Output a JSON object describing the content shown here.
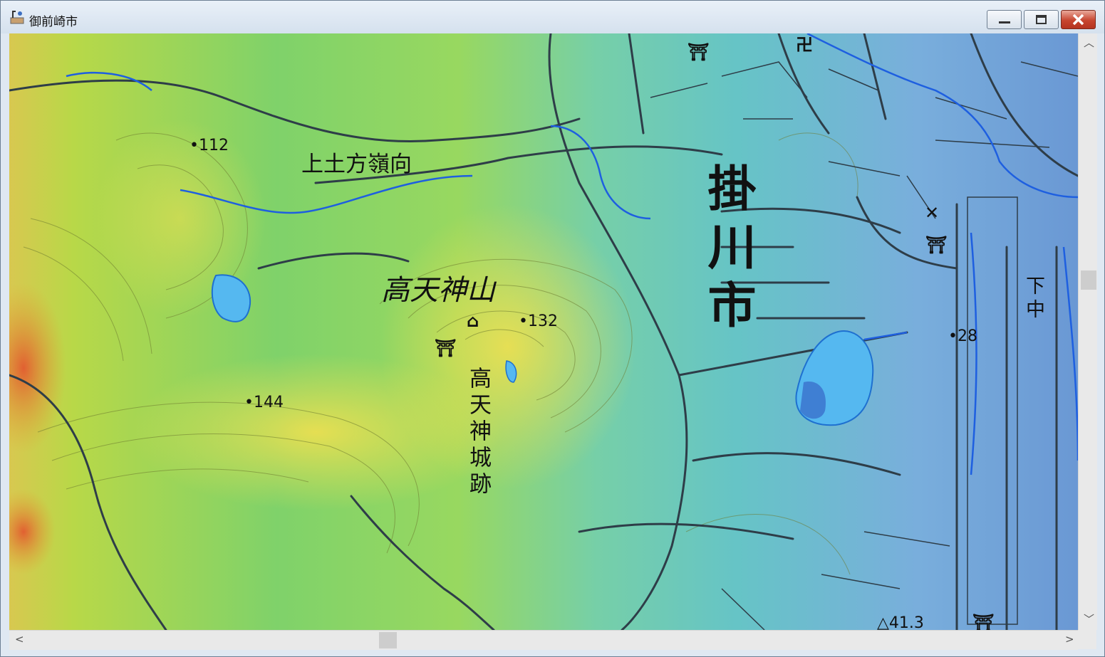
{
  "window": {
    "title": "御前崎市"
  },
  "map": {
    "labels": {
      "kamihijikata": "上土方嶺向",
      "takatenjinyama": "高天神山",
      "castle_ruins": "高天神城跡",
      "kakegawa": "掛川市",
      "shimonaka": "下中"
    },
    "elevations": {
      "e112": "112",
      "e132": "132",
      "e144": "144",
      "e28": "28",
      "e41": "41.3"
    },
    "symbols": [
      "shrine-icon",
      "temple-icon",
      "police-box-icon",
      "triangulation-point-icon",
      "paddy-field-icon"
    ]
  },
  "colors": {
    "high": "#e06030",
    "mid_high": "#d8d840",
    "mid": "#70d060",
    "low": "#60c8c8",
    "lowest": "#6f9fd6",
    "water": "#55b8f0",
    "road": "#3a4a55"
  }
}
